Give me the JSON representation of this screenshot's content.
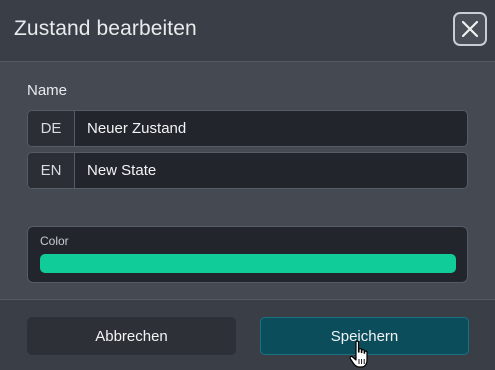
{
  "dialog": {
    "title": "Zustand bearbeiten",
    "close_icon": "close-icon"
  },
  "name_section": {
    "label": "Name",
    "fields": [
      {
        "lang": "DE",
        "value": "Neuer Zustand"
      },
      {
        "lang": "EN",
        "value": "New State"
      }
    ]
  },
  "color_section": {
    "label": "Color",
    "value": "#10cc98"
  },
  "footer": {
    "cancel_label": "Abbrechen",
    "save_label": "Speichern"
  },
  "cursor_icon": "hand-pointer-icon",
  "colors": {
    "header_bg": "#3a3f47",
    "body_bg": "#454a52",
    "input_bg": "#22262c",
    "accent_save": "#0c4d5c"
  }
}
